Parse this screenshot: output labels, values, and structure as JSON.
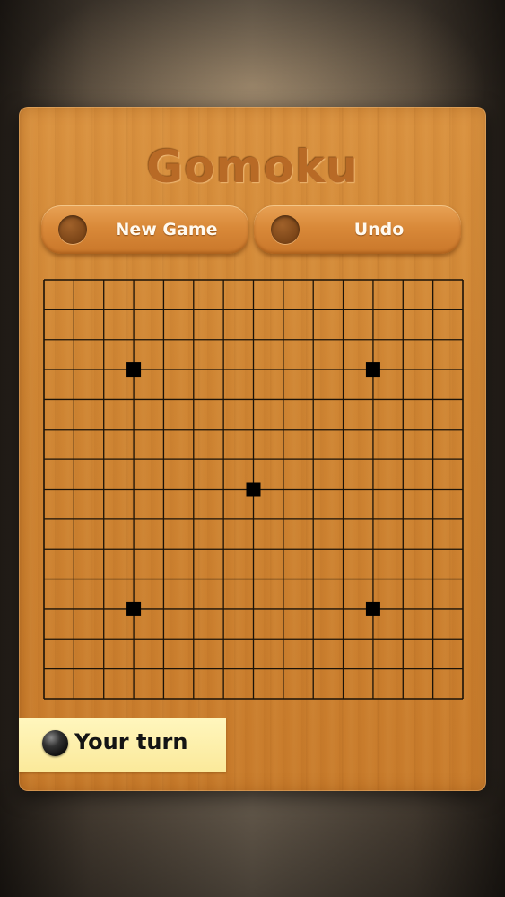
{
  "app": {
    "title": "Gomoku"
  },
  "buttons": {
    "new_game": "New Game",
    "undo": "Undo"
  },
  "board": {
    "size": 15,
    "lines": 15,
    "star_points": [
      [
        3,
        3
      ],
      [
        3,
        11
      ],
      [
        7,
        7
      ],
      [
        11,
        3
      ],
      [
        11,
        11
      ]
    ],
    "stones": []
  },
  "status": {
    "text": "Your turn",
    "stone_color": "black"
  },
  "colors": {
    "board_line": "#1a1208",
    "star_point": "#000000"
  }
}
